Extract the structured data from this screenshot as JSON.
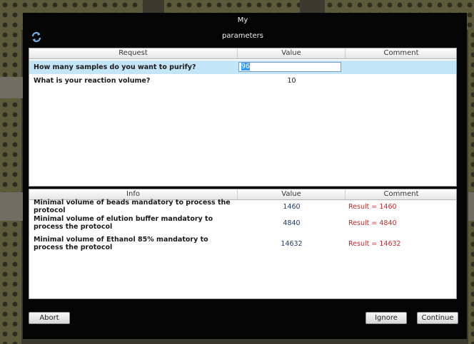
{
  "dialog": {
    "title": "My parameters"
  },
  "requests": {
    "columns": [
      "Request",
      "Value",
      "Comment"
    ],
    "rows": [
      {
        "question": "How many samples do you want to purify?",
        "value": "96",
        "comment": ""
      },
      {
        "question": "What is your reaction volume?",
        "value": "10",
        "comment": ""
      }
    ]
  },
  "info": {
    "columns": [
      "Info",
      "Value",
      "Comment"
    ],
    "rows": [
      {
        "label": "Minimal volume of beads mandatory to process the protocol",
        "value": "1460",
        "comment": "Result = 1460"
      },
      {
        "label": "Minimal volume of elution buffer mandatory to process the protocol",
        "value": "4840",
        "comment": "Result = 4840"
      },
      {
        "label": "Minimal volume of Ethanol 85% mandatory to process the protocol",
        "value": "14632",
        "comment": "Result = 14632"
      }
    ]
  },
  "buttons": {
    "abort": "Abort",
    "ignore": "Ignore",
    "continue": "Continue"
  },
  "colors": {
    "selection": "#c4e4f7",
    "comment_red": "#c0282a",
    "value_blue": "#1f3a68",
    "dialog_bg": "#050505"
  },
  "icons": {
    "refresh": "refresh-icon"
  }
}
